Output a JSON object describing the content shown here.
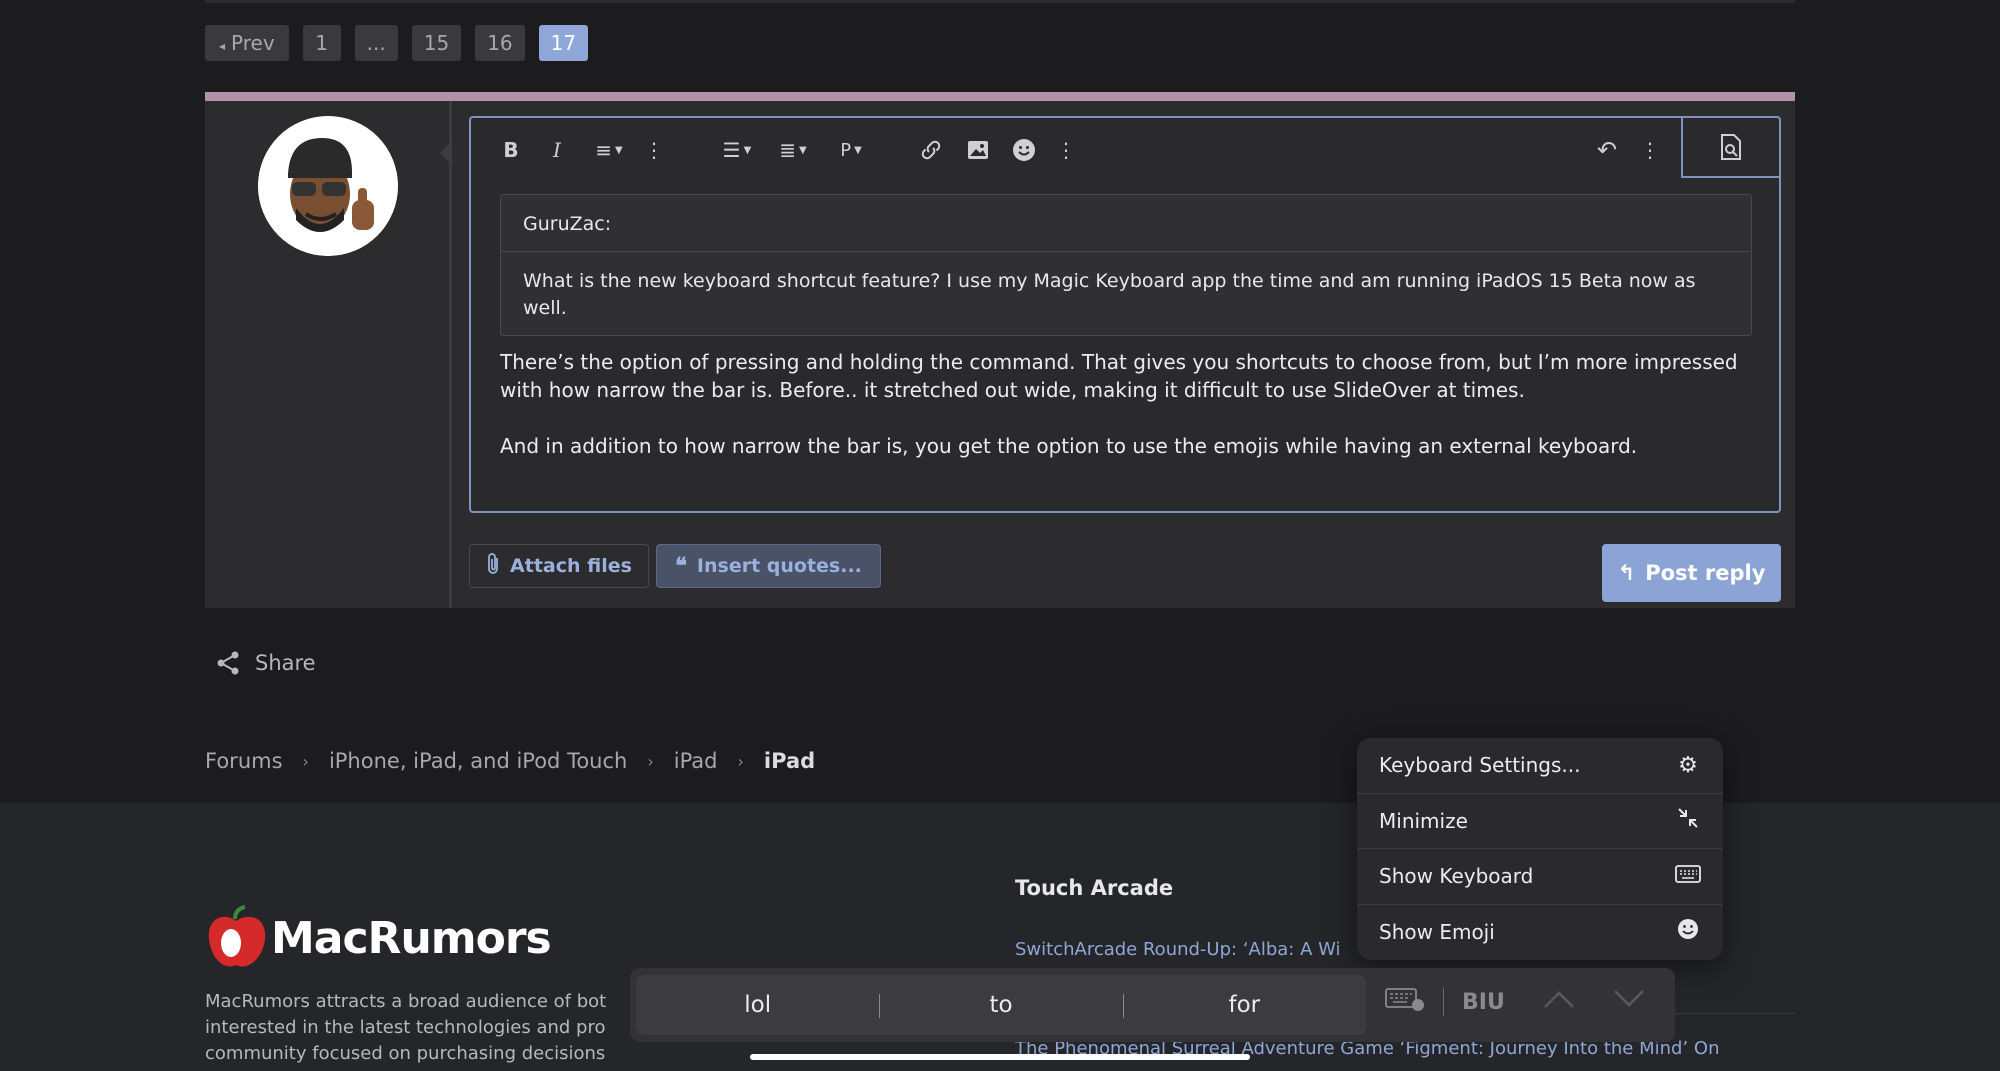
{
  "pagination": {
    "prev_label": "Prev",
    "pages": [
      "1",
      "...",
      "15",
      "16",
      "17"
    ],
    "current": "17"
  },
  "editor": {
    "quote_author": "GuruZac:",
    "quote_text": "What is the new keyboard shortcut feature? I use my Magic Keyboard app the time and am running iPadOS 15 Beta now as well.",
    "paragraph1": "There’s the option of pressing and holding the command. That gives you shortcuts to choose from, but I’m more impressed with how narrow the bar is. Before.. it stretched out wide, making it difficult to use SlideOver at times.",
    "paragraph2": "And in addition to how narrow the bar is, you get the option to use the emojis while having an external keyboard."
  },
  "buttons": {
    "attach": "Attach files",
    "insert_quotes": "Insert quotes...",
    "post_reply": "Post reply"
  },
  "share_label": "Share",
  "breadcrumb": {
    "items": [
      "Forums",
      "iPhone, iPad, and iPod Touch",
      "iPad"
    ],
    "current": "iPad"
  },
  "footer": {
    "logo_text": "MacRumors",
    "about": "MacRumors attracts a broad audience of bot interested in the latest technologies and pro community focused on purchasing decisions and technical aspects of the iPhone,",
    "touch_arcade_heading": "Touch Arcade",
    "link1": "SwitchArcade Round-Up: ‘Alba: A Wi",
    "link2": "The Phenomenal Surreal Adventure Game ‘Figment: Journey Into the Mind’ On"
  },
  "menu": {
    "items": [
      {
        "label": "Keyboard Settings...",
        "icon": "gear-icon"
      },
      {
        "label": "Minimize",
        "icon": "minimize-icon"
      },
      {
        "label": "Show Keyboard",
        "icon": "keyboard-icon"
      },
      {
        "label": "Show Emoji",
        "icon": "emoji-icon"
      }
    ]
  },
  "keyboard": {
    "suggestions": [
      "lol",
      "to",
      "for"
    ],
    "format_label": "BIU"
  },
  "colors": {
    "accent": "#8fa6d8",
    "post_button": "#8ca3d6",
    "reply_top_border": "#b491a8",
    "background": "#1c1c1e"
  }
}
